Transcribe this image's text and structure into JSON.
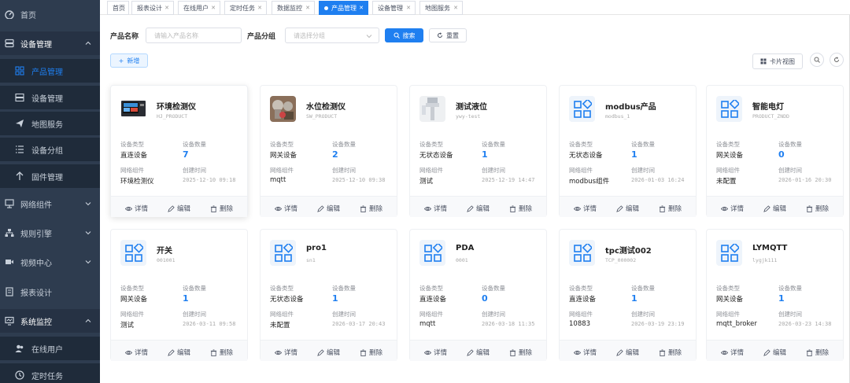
{
  "sidebar": {
    "items": [
      {
        "label": "首页",
        "icon": "dashboard-icon",
        "level": 0
      },
      {
        "label": "设备管理",
        "icon": "device-manage-icon",
        "level": 0,
        "expanded": true
      },
      {
        "label": "产品管理",
        "icon": "grid-icon",
        "level": 1,
        "active": true
      },
      {
        "label": "设备管理",
        "icon": "server-icon",
        "level": 1
      },
      {
        "label": "地图服务",
        "icon": "send-icon",
        "level": 1
      },
      {
        "label": "设备分组",
        "icon": "list-icon",
        "level": 1
      },
      {
        "label": "固件管理",
        "icon": "upload-icon",
        "level": 1
      },
      {
        "label": "网络组件",
        "icon": "network-icon",
        "level": 0
      },
      {
        "label": "规则引擎",
        "icon": "rule-icon",
        "level": 0
      },
      {
        "label": "视频中心",
        "icon": "video-icon",
        "level": 0
      },
      {
        "label": "报表设计",
        "icon": "report-icon",
        "level": 0
      },
      {
        "label": "系统监控",
        "icon": "monitor-icon",
        "level": 0,
        "expanded": true
      },
      {
        "label": "在线用户",
        "icon": "users-icon",
        "level": 1
      },
      {
        "label": "定时任务",
        "icon": "clock-icon",
        "level": 1
      }
    ]
  },
  "tabs": [
    {
      "label": "首页",
      "closable": false
    },
    {
      "label": "报表设计",
      "closable": true
    },
    {
      "label": "在线用户",
      "closable": true
    },
    {
      "label": "定时任务",
      "closable": true
    },
    {
      "label": "数据监控",
      "closable": true
    },
    {
      "label": "产品管理",
      "closable": true,
      "active": true
    },
    {
      "label": "设备管理",
      "closable": true
    },
    {
      "label": "地图服务",
      "closable": true
    }
  ],
  "filters": {
    "name_label": "产品名称",
    "name_placeholder": "请输入产品名称",
    "group_label": "产品分组",
    "group_placeholder": "请选择分组",
    "search_label": "搜索",
    "reset_label": "重置"
  },
  "toolbar": {
    "add_label": "新增",
    "card_view_label": "卡片视图"
  },
  "card_labels": {
    "type_label": "设备类型",
    "count_label": "设备数量",
    "component_label": "网络组件",
    "created_label": "创建时间",
    "detail_label": "详情",
    "edit_label": "编辑",
    "delete_label": "删除"
  },
  "products": [
    {
      "name": "环境检测仪",
      "code": "HJ_PRODUCT",
      "type": "直连设备",
      "count": "7",
      "component": "环境检测仪",
      "created": "2025-12-10 09:18",
      "image": "device-panel"
    },
    {
      "name": "水位检测仪",
      "code": "SW_PRODUCT",
      "type": "网关设备",
      "count": "2",
      "component": "mqtt",
      "created": "2025-12-10 09:38",
      "image": "water-sensor"
    },
    {
      "name": "测试液位",
      "code": "ywy-test",
      "type": "无状态设备",
      "count": "1",
      "component": "测试",
      "created": "2025-12-19 14:47",
      "image": "level-sensor"
    },
    {
      "name": "modbus产品",
      "code": "modbus_1",
      "type": "无状态设备",
      "count": "1",
      "component": "modbus组件",
      "created": "2026-01-03 16:24",
      "image": "default"
    },
    {
      "name": "智能电灯",
      "code": "PRODUCT_ZNDD",
      "type": "网关设备",
      "count": "0",
      "component": "未配置",
      "created": "2026-01-16 20:30",
      "image": "default"
    },
    {
      "name": "开关",
      "code": "001001",
      "type": "网关设备",
      "count": "1",
      "component": "测试",
      "created": "2026-03-11 09:58",
      "image": "default"
    },
    {
      "name": "pro1",
      "code": "sn1",
      "type": "无状态设备",
      "count": "1",
      "component": "未配置",
      "created": "2026-03-17 20:43",
      "image": "default"
    },
    {
      "name": "PDA",
      "code": "0001",
      "type": "直连设备",
      "count": "0",
      "component": "mqtt",
      "created": "2026-03-18 11:35",
      "image": "default"
    },
    {
      "name": "tpc测试002",
      "code": "TCP_000002",
      "type": "直连设备",
      "count": "1",
      "component": "10883",
      "created": "2026-03-19 23:19",
      "image": "default"
    },
    {
      "name": "LYMQTT",
      "code": "lygjk111",
      "type": "网关设备",
      "count": "1",
      "component": "mqtt_broker",
      "created": "2026-03-23 14:38",
      "image": "default"
    }
  ],
  "colors": {
    "sidebar_bg": "#2e3c4f",
    "accent": "#1f7ff0"
  }
}
